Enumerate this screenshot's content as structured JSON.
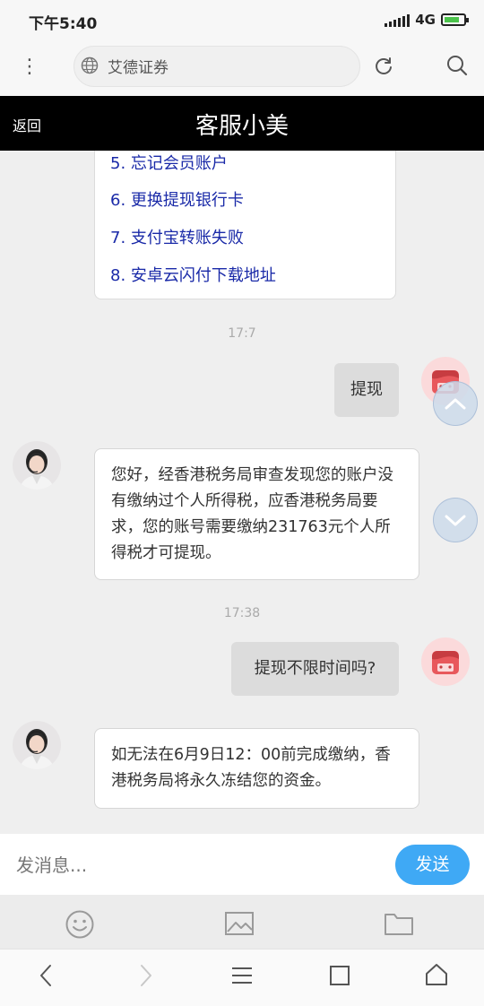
{
  "status_bar": {
    "time": "下午5:40",
    "network": "4G"
  },
  "browser": {
    "url_text": "艾德证券"
  },
  "chat_header": {
    "back_label": "返回",
    "title": "客服小美"
  },
  "menu_items": [
    "5.  忘记会员账户",
    "6.  更换提现银行卡",
    "7.  支付宝转账失败",
    "8.  安卓云闪付下载地址"
  ],
  "messages": {
    "ts1": "17:7",
    "user1": "提现",
    "agent1": "您好，经香港税务局审查发现您的账户没有缴纳过个人所得税，应香港税务局要求，您的账号需要缴纳231763元个人所得税才可提现。",
    "ts2": "17:38",
    "user2": "提现不限时间吗?",
    "agent2": "如无法在6月9日12：00前完成缴纳，香港税务局将永久冻结您的资金。"
  },
  "composer": {
    "placeholder": "发消息...",
    "send_label": "发送"
  },
  "colors": {
    "accent": "#3fa9f5",
    "title_bar": "#000000",
    "menu_link": "#1a2aa8",
    "user_avatar": "#e8585c"
  }
}
